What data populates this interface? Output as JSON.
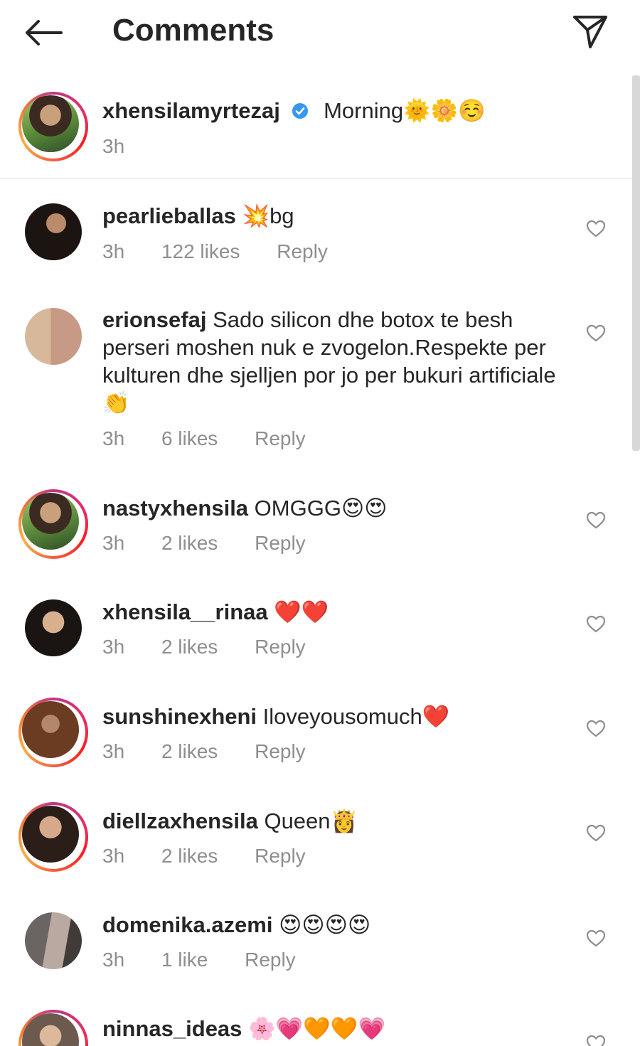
{
  "header": {
    "title": "Comments",
    "back_icon": "arrow-left-icon",
    "send_icon": "paper-plane-icon"
  },
  "caption": {
    "username": "xhensilamyrtezaj",
    "text": "Morning🌞🌼☺️",
    "time": "3h",
    "verified": true
  },
  "comments": [
    {
      "username": "pearlieballas",
      "text": "💥bg",
      "time": "3h",
      "likes": "122 likes",
      "reply": "Reply",
      "ring": false
    },
    {
      "username": "erionsefaj",
      "text": "Sado silicon dhe botox te besh perseri moshen nuk e zvogelon.Respekte per kulturen dhe sjelljen por jo per bukuri artificiale 👏",
      "time": "3h",
      "likes": "6 likes",
      "reply": "Reply",
      "ring": false
    },
    {
      "username": "nastyxhensila",
      "text": "OMGGG😍😍",
      "time": "3h",
      "likes": "2 likes",
      "reply": "Reply",
      "ring": true
    },
    {
      "username": "xhensila__rinaa",
      "text": "❤️❤️",
      "time": "3h",
      "likes": "2 likes",
      "reply": "Reply",
      "ring": false
    },
    {
      "username": "sunshinexheni",
      "text": "Iloveyousomuch❤️",
      "time": "3h",
      "likes": "2 likes",
      "reply": "Reply",
      "ring": true
    },
    {
      "username": "diellzaxhensila",
      "text": "Queen👸",
      "time": "3h",
      "likes": "2 likes",
      "reply": "Reply",
      "ring": true
    },
    {
      "username": "domenika.azemi",
      "text": "😍😍😍😍",
      "time": "3h",
      "likes": "1 like",
      "reply": "Reply",
      "ring": false
    },
    {
      "username": "ninnas_ideas",
      "text": "🌸💗🧡🧡💗",
      "time": "",
      "likes": "",
      "reply": "",
      "ring": true
    }
  ],
  "colors": {
    "text": "#262626",
    "meta": "#8e8e8e",
    "verified": "#3897f0"
  }
}
